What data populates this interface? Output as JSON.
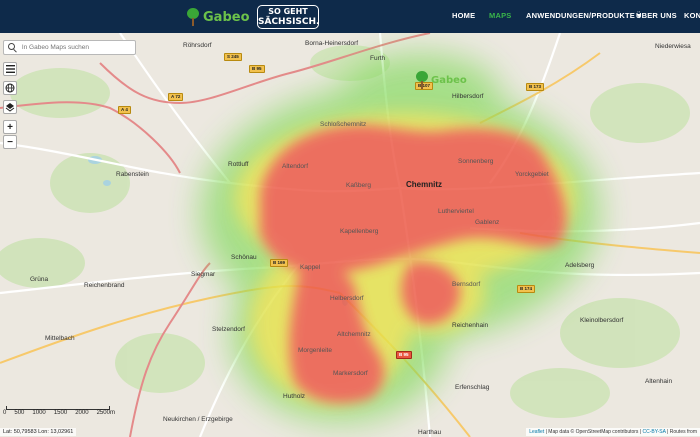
{
  "header": {
    "logo_text": "Gabeo",
    "sachsen_line1": "SO GEHT",
    "sachsen_line2": "SÄCHSISCH.",
    "nav": [
      "HOME",
      "MAPS",
      "ANWENDUNGEN/PRODUKTE ▾",
      "ÜBER UNS",
      "KON"
    ]
  },
  "search": {
    "placeholder": "In Gabeo Maps suchen"
  },
  "controls": {
    "zoom_in": "+",
    "zoom_out": "−"
  },
  "map": {
    "overlay_logo": "Gabeo",
    "places": [
      "Röhrsdorf",
      "Borna-Heinersdorf",
      "Furth",
      "Niederwiesa",
      "Hilbersdorf",
      "Schloßchemnitz",
      "Altendorf",
      "Sonnenberg",
      "Yorckgebiet",
      "Kaßberg",
      "Chemnitz",
      "Rottluff",
      "Rabenstein",
      "Lutherviertel",
      "Gablenz",
      "Kapellenberg",
      "Schönau",
      "Kappel",
      "Siegmar",
      "Helbersdorf",
      "Bernsdorf",
      "Adelsberg",
      "Reichenbrand",
      "Grüna",
      "Stelzendorf",
      "Altchemnitz",
      "Reichenhain",
      "Kleinolbersdorf",
      "Mittelbach",
      "Morgenleite",
      "Markersdorf",
      "Erfenschlag",
      "Hutholz",
      "Altenhain",
      "Neukirchen / Erzgebirge",
      "Harthau"
    ],
    "roads": [
      "B 95",
      "B 107",
      "B 173",
      "B 169",
      "B 174",
      "A 4",
      "A 72",
      "S 245",
      "B 95"
    ]
  },
  "scale": {
    "labels": [
      "0",
      "500",
      "1000",
      "1500",
      "2000",
      "2500m"
    ]
  },
  "coords": "Lat: 50,79583 Lon: 13,02961",
  "attribution": {
    "leaflet": "Leaflet",
    "text": " | Map data © OpenStreetMap contributors | ",
    "license": "CC-BY-SA",
    "rest": " | Routes from"
  }
}
